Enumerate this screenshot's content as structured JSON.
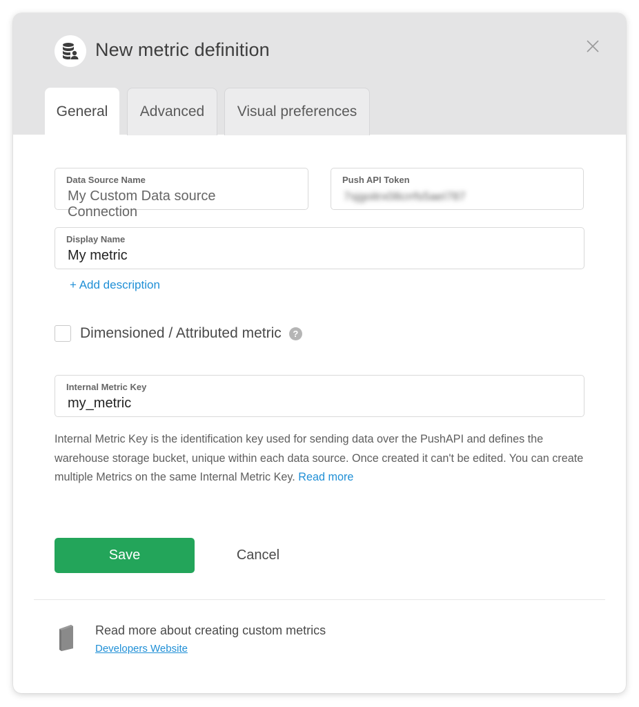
{
  "dialog": {
    "title": "New metric definition",
    "title_icon": "database-user-icon",
    "close_icon": "close-icon"
  },
  "tabs": [
    {
      "label": "General",
      "active": true
    },
    {
      "label": "Advanced",
      "active": false
    },
    {
      "label": "Visual preferences",
      "active": false
    }
  ],
  "form": {
    "data_source": {
      "label": "Data Source Name",
      "value": "My Custom Data source Connection"
    },
    "push_token": {
      "label": "Push API Token",
      "value": "7sjgoitrx08crrfs5aeI787"
    },
    "display_name": {
      "label": "Display Name",
      "value": "My metric"
    },
    "add_description": "+ Add description",
    "dimensioned": {
      "label": "Dimensioned / Attributed metric",
      "checked": false,
      "help_icon": "question-icon",
      "help_glyph": "?"
    },
    "internal_key": {
      "label": "Internal Metric Key",
      "value": "my_metric"
    },
    "help_text": "Internal Metric Key is the identification key used for sending data over the PushAPI and defines the warehouse storage bucket, unique within each data source. Once created it can't be edited. You can create multiple Metrics on the same Internal Metric Key.",
    "read_more": "Read more"
  },
  "actions": {
    "save": "Save",
    "cancel": "Cancel"
  },
  "footer": {
    "icon": "book-icon",
    "text": "Read more about creating custom metrics",
    "link": "Developers Website"
  },
  "colors": {
    "accent_green": "#23a55a",
    "link_blue": "#1f8fd6",
    "header_gray": "#e4e4e5"
  }
}
